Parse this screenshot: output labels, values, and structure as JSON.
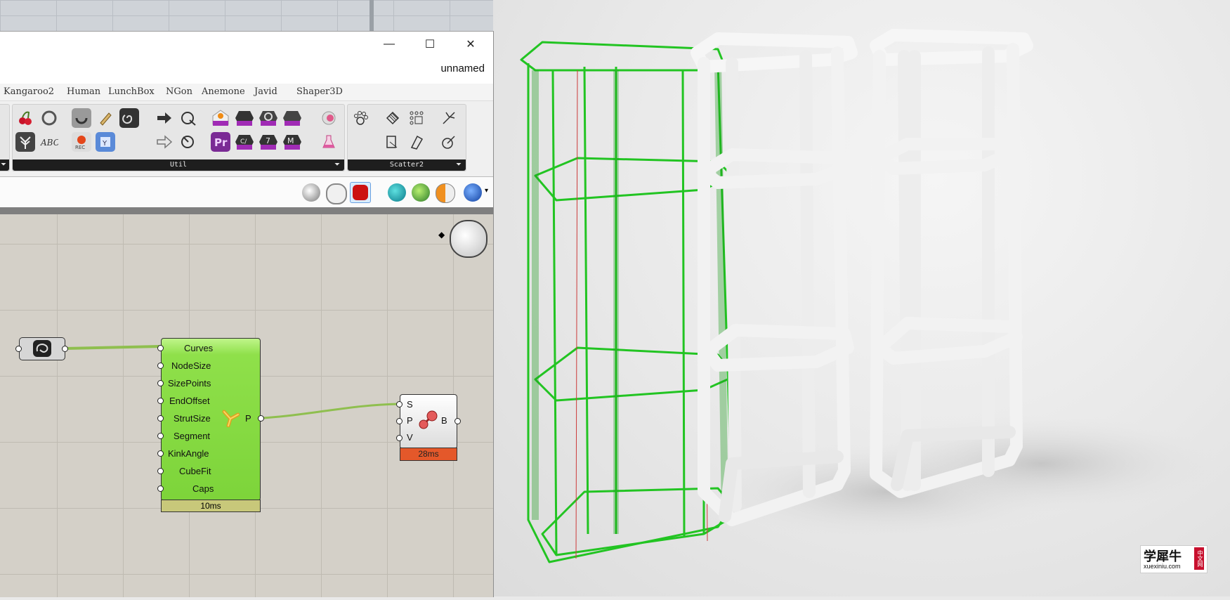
{
  "window": {
    "doc_name": "unnamed",
    "minimize_glyph": "—",
    "maximize_glyph": "☐",
    "close_glyph": "✕"
  },
  "menu_tabs": [
    "Kangaroo2",
    "Human",
    "LunchBox",
    "NGon",
    "Anemone",
    "Javid",
    "Shaper3D"
  ],
  "ribbon": {
    "util_label": "Util",
    "scatter_label": "Scatter2",
    "expand_glyph": "⏷"
  },
  "components": {
    "multipipe": {
      "inputs": [
        "Curves",
        "NodeSize",
        "SizePoints",
        "EndOffset",
        "StrutSize",
        "Segment",
        "KinkAngle",
        "CubeFit",
        "Caps"
      ],
      "output": "P",
      "time": "10ms"
    },
    "custom_preview": {
      "inputs": [
        "S",
        "P",
        "V"
      ],
      "output": "B",
      "time": "28ms"
    }
  },
  "watermark": {
    "brand": "学犀牛",
    "url": "xuexiniu.com",
    "tag": "中文网"
  },
  "colors": {
    "component_green": "#8fe04a",
    "time_red": "#e4582a",
    "wire_green": "#8fbf4f",
    "mesh_green": "#22c422"
  }
}
